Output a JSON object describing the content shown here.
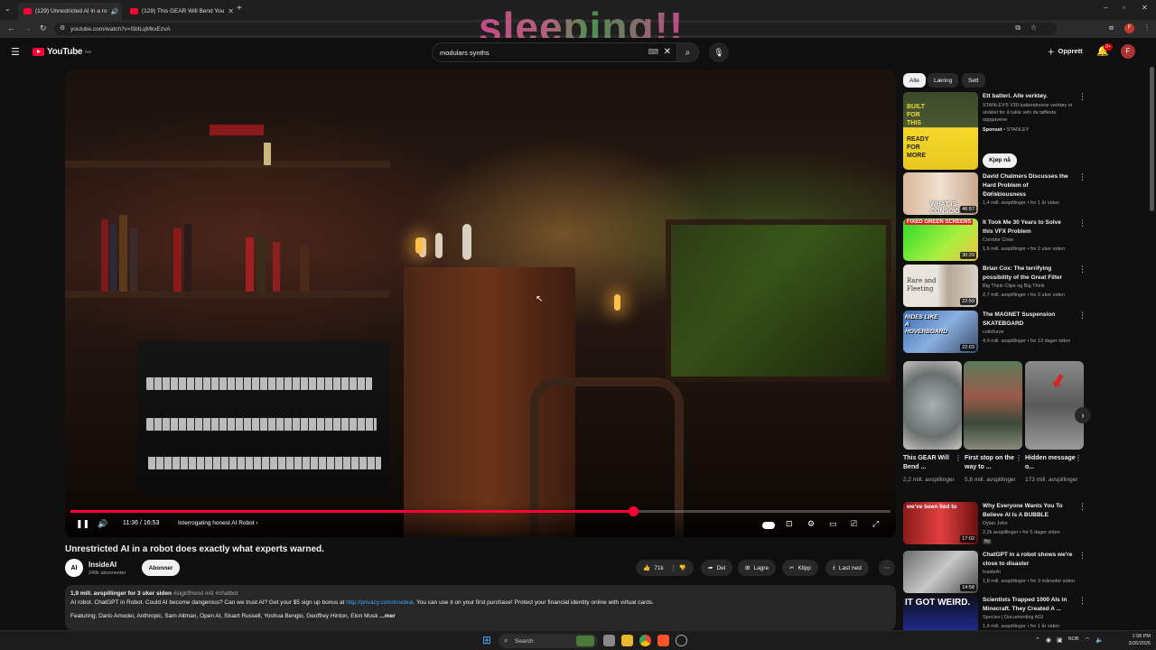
{
  "browser": {
    "tabs": [
      {
        "title": "(129) Unrestricted AI in a ro"
      },
      {
        "title": "(129) This GEAR Will Bend You"
      }
    ],
    "url": "youtube.com/watch?v=SbILqMkxEzvA",
    "overlay_text": "sleeping!!"
  },
  "header": {
    "logo": "YouTube",
    "logo_sup": "NO",
    "search_value": "modulars synths",
    "create_label": "Opprett",
    "notif_count": "9+",
    "avatar": "F"
  },
  "player": {
    "time": "11:36 / 16:53",
    "chapter": "Interrogating honest AI Robot",
    "progress": 0.6863
  },
  "video": {
    "title": "Unrestricted AI in a robot does exactly what experts warned.",
    "channel": "InsideAI",
    "channel_avatar": "AI",
    "subscribers": "249k abonnenter",
    "subscribe": "Abonner",
    "likes": "71k",
    "share": "Del",
    "save": "Lagre",
    "clip": "Klipp",
    "download": "Last ned"
  },
  "description": {
    "meta": "1,9 mill. avspillinger  for 3 uker siden",
    "tags": "#sigirlfriend #AI #chatbot",
    "line1a": "AI robot. ChatGPT in Robot. Could AI become dangerous? Can we trust AI? Get your $5 sign up bonus at ",
    "link": "http://privacy.com/insideai",
    "line1b": ". You can use it on your first purchase! Protect your financial identity online with virtual cards.",
    "line2": "Featuring; Dario Amodei, Anthropic, Sam Altman, Open AI, Stuart Russell, Yoshua Bengio, Geoffrey Hinton, Elon Musk",
    "more": "...mer"
  },
  "sidebar": {
    "chips": [
      "Alle",
      "Læring",
      "Sett"
    ],
    "ad": {
      "title": "Ett batteri. Alle verktøy.",
      "body": "STANLEY® V20 batteridrevne verktøy er utviklet for å takle selv de tøffeste oppgavene",
      "sponsor_label": "Sponset",
      "sponsor": "STANLEY",
      "thumb_top": "BUILT FOR THIS",
      "thumb_bottom": "READY FOR MORE",
      "cta": "Kjøp nå"
    },
    "videos": [
      {
        "title": "David Chalmers Discusses the Hard Problem of Consciousness",
        "channel": "StarTalk",
        "meta": "1,4 mill. avspillinger • for 1 år siden",
        "duration": "46:57",
        "thumb_text": "WHAT IS CONSCIOUSNESS"
      },
      {
        "title": "It Took Me 30 Years to Solve this VFX Problem",
        "channel": "Corridor Crew",
        "meta": "1,6 mill. avspillinger • for 2 uker siden",
        "duration": "30:29",
        "thumb_text": "FIXED GREEN SCREENS"
      },
      {
        "title": "Brian Cox: The terrifying possibility of the Great Filter",
        "channel": "Big Think Clips og Big Think",
        "meta": "2,7 mill. avspillinger • for 3 uker siden",
        "duration": "22:59",
        "thumb_text": "Rare and Fleeting"
      },
      {
        "title": "The MAGNET Suspension SKATEBOARD",
        "channel": "colinfurze",
        "meta": "4,9 mill. avspillinger • for 13 dager siden",
        "duration": "22:03",
        "thumb_text": "RIDES LIKE A HOVERBOARD"
      }
    ],
    "shorts": [
      {
        "title": "This GEAR Will Bend ...",
        "views": "2,2 mill. avspillinger"
      },
      {
        "title": "First stop on the way to ...",
        "views": "5,8 mill. avspillinger"
      },
      {
        "title": "Hidden message o...",
        "views": "173 mill. avspillinger"
      }
    ],
    "videos2": [
      {
        "title": "Why Everyone Wants You To Believe AI Is A BUBBLE",
        "channel": "Dylan John",
        "meta": "2,2k avspillinger • for 5 dager siden",
        "badge": "Ny",
        "duration": "17:02",
        "thumb_text": "we've been lied to"
      },
      {
        "title": "ChatGPT in a robot shows we're close to disaster",
        "channel": "InsideAI",
        "meta": "1,8 mill. avspillinger • for 3 måneder siden",
        "duration": "14:58",
        "thumb_text": ""
      },
      {
        "title": "Scientists Trapped 1000 AIs in Minecraft. They Created A ...",
        "channel": "Species | Documenting AGI",
        "meta": "1,4 mill. avspillinger • for 1 år siden",
        "duration": "",
        "thumb_text": "IT GOT WEIRD."
      }
    ]
  },
  "taskbar": {
    "search": "Search",
    "lang": "NOB",
    "time": "1:58 PM",
    "date": "3/26/2026"
  },
  "colors": {
    "accent": "#ff0033",
    "bg": "#0f0f0f",
    "pill": "#272727",
    "link": "#3ea6ff"
  }
}
